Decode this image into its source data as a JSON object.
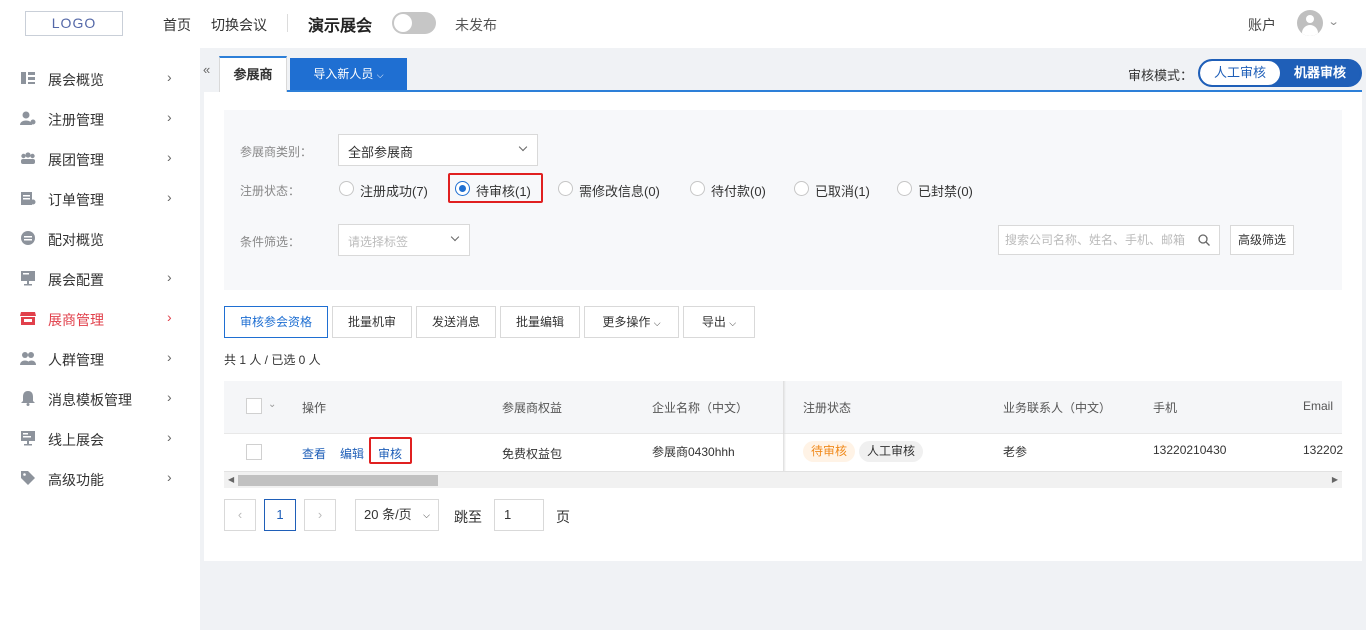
{
  "header": {
    "logo": "LOGO",
    "nav": [
      "首页",
      "切换会议"
    ],
    "event_name": "演示展会",
    "publish_status": "未发布",
    "account": "账户"
  },
  "sidebar": {
    "items": [
      {
        "label": "展会概览",
        "icon": "dashboard-icon",
        "has_chevron": true
      },
      {
        "label": "注册管理",
        "icon": "user-register-icon",
        "has_chevron": true
      },
      {
        "label": "展团管理",
        "icon": "group-icon",
        "has_chevron": true
      },
      {
        "label": "订单管理",
        "icon": "order-icon",
        "has_chevron": true
      },
      {
        "label": "配对概览",
        "icon": "match-icon",
        "has_chevron": false
      },
      {
        "label": "展会配置",
        "icon": "config-icon",
        "has_chevron": true
      },
      {
        "label": "展商管理",
        "icon": "store-icon",
        "has_chevron": true,
        "active": true
      },
      {
        "label": "人群管理",
        "icon": "people-icon",
        "has_chevron": true
      },
      {
        "label": "消息模板管理",
        "icon": "bell-icon",
        "has_chevron": true
      },
      {
        "label": "线上展会",
        "icon": "monitor-icon",
        "has_chevron": true
      },
      {
        "label": "高级功能",
        "icon": "tag-icon",
        "has_chevron": true
      }
    ],
    "active_color": "#e1404b"
  },
  "tabs": {
    "active": "参展商",
    "import_button": "导入新人员"
  },
  "review_mode": {
    "label": "审核模式：",
    "options": [
      "人工审核",
      "机器审核"
    ],
    "selected": "机器审核"
  },
  "filters": {
    "category_label": "参展商类别：",
    "category_value": "全部参展商",
    "status_label": "注册状态：",
    "status_options": [
      {
        "label": "注册成功(7)",
        "checked": false
      },
      {
        "label": "待审核(1)",
        "checked": true
      },
      {
        "label": "需修改信息(0)",
        "checked": false
      },
      {
        "label": "待付款(0)",
        "checked": false
      },
      {
        "label": "已取消(1)",
        "checked": false
      },
      {
        "label": "已封禁(0)",
        "checked": false
      }
    ],
    "condition_label": "条件筛选：",
    "condition_placeholder": "请选择标签",
    "search_placeholder": "搜索公司名称、姓名、手机、邮箱",
    "advanced_button": "高级筛选"
  },
  "actions": {
    "buttons": [
      "审核参会资格",
      "批量机审",
      "发送消息",
      "批量编辑",
      "更多操作",
      "导出"
    ],
    "count_text": "共 1 人 / 已选 0 人"
  },
  "table": {
    "headers": [
      "操作",
      "参展商权益",
      "企业名称（中文）",
      "注册状态",
      "业务联系人（中文）",
      "手机",
      "Email"
    ],
    "rows": [
      {
        "actions": [
          "查看",
          "编辑",
          "审核"
        ],
        "benefit": "免费权益包",
        "company": "参展商0430hhh",
        "status_tags": [
          "待审核",
          "人工审核"
        ],
        "contact": "老参",
        "phone": "13220210430",
        "email": "132202"
      }
    ]
  },
  "pagination": {
    "current_page": "1",
    "page_size": "20 条/页",
    "goto_label": "跳至",
    "goto_value": "1",
    "page_suffix": "页"
  },
  "colors": {
    "primary": "#1f6fd2",
    "highlight_box": "#e02020",
    "pending_tag": "#f08a1c"
  }
}
